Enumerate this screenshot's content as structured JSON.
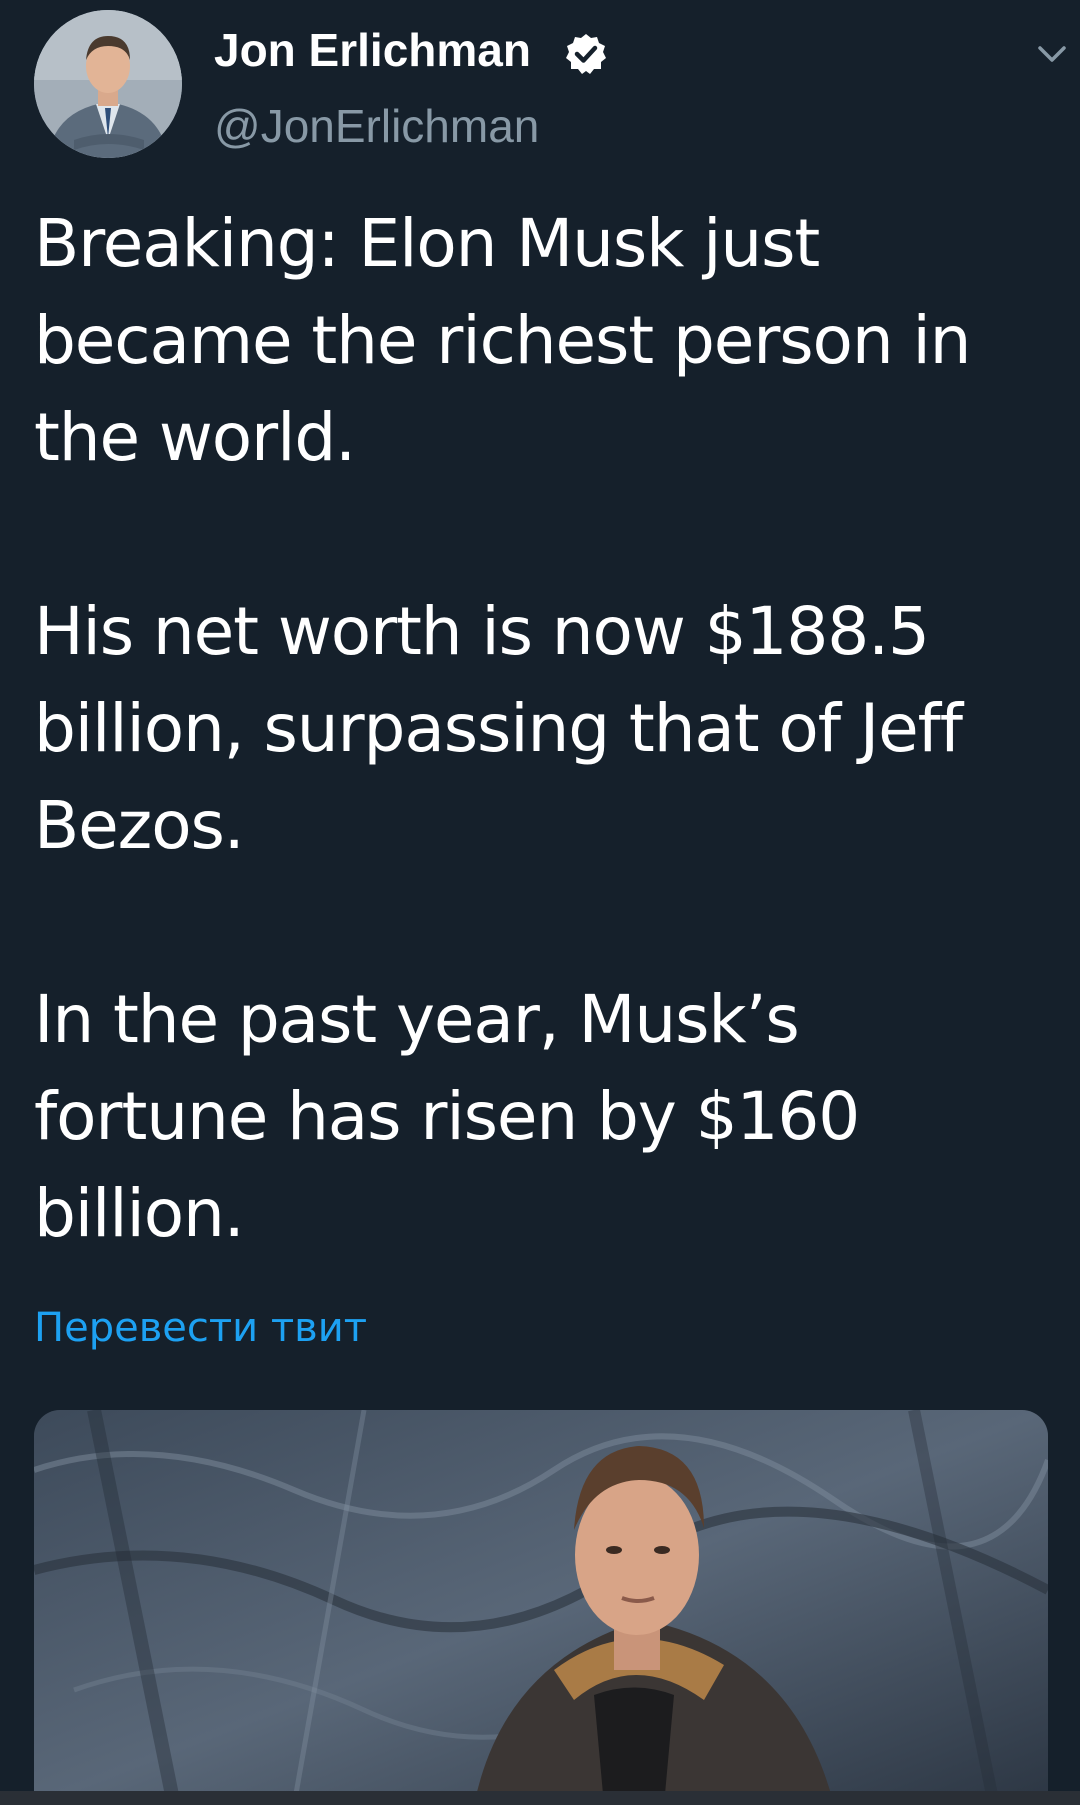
{
  "tweet": {
    "author": {
      "name": "Jon Erlichman",
      "handle": "@JonErlichman",
      "verified": true,
      "avatar_icon": "user-avatar"
    },
    "text_paragraphs": [
      "Breaking: Elon Musk just\nbecame the richest person in\nthe world.",
      "His net worth is now $188.5\nbillion, surpassing that of Jeff\nBezos.",
      "In the past year, Musk’s\nfortune has risen by $160\nbillion."
    ],
    "translate_label": "Перевести твит",
    "media": {
      "type": "photo"
    },
    "icons": {
      "verified": "verified-badge-icon",
      "more": "chevron-down-icon"
    }
  },
  "colors": {
    "background": "#15202b",
    "text": "#ffffff",
    "secondary_text": "#8899a6",
    "link": "#1da1f2"
  }
}
